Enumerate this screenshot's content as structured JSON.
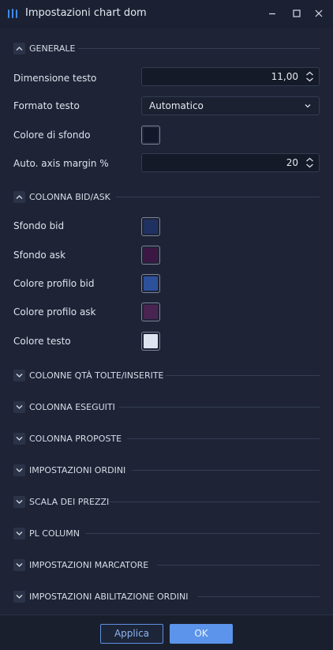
{
  "window": {
    "title": "Impostazioni chart dom",
    "icon": "chart-dom-icon",
    "controls": [
      "minimize-icon",
      "maximize-icon",
      "close-icon"
    ]
  },
  "generale": {
    "title": "GENERALE",
    "expanded": true,
    "dimensione_testo": {
      "label": "Dimensione testo",
      "value": "11,00"
    },
    "formato_testo": {
      "label": "Formato testo",
      "value": "Automatico"
    },
    "colore_sfondo": {
      "label": "Colore di sfondo",
      "color": "#12172a"
    },
    "axis_margin": {
      "label": "Auto. axis margin %",
      "value": "20"
    }
  },
  "colonna_bid_ask": {
    "title": "COLONNA BID/ASK",
    "expanded": true,
    "sfondo_bid": {
      "label": "Sfondo bid",
      "color": "#1f3160"
    },
    "sfondo_ask": {
      "label": "Sfondo ask",
      "color": "#3b1843"
    },
    "profilo_bid": {
      "label": "Colore profilo bid",
      "color": "#2c519a"
    },
    "profilo_ask": {
      "label": "Colore profilo ask",
      "color": "#4a2451"
    },
    "colore_testo": {
      "label": "Colore testo",
      "color": "#dfe4f1"
    }
  },
  "collapsed_sections": [
    "COLONNE QTÀ TOLTE/INSERITE",
    "COLONNA ESEGUITI",
    "COLONNA PROPOSTE",
    "IMPOSTAZIONI ORDINI",
    "SCALA DEI PREZZI",
    "PL COLUMN",
    "IMPOSTAZIONI MARCATORE",
    "IMPOSTAZIONI ABILITAZIONE ORDINI"
  ],
  "footer": {
    "apply": "Applica",
    "ok": "OK"
  },
  "colors": {
    "accent": "#5b94ea",
    "background": "#1e2436"
  }
}
